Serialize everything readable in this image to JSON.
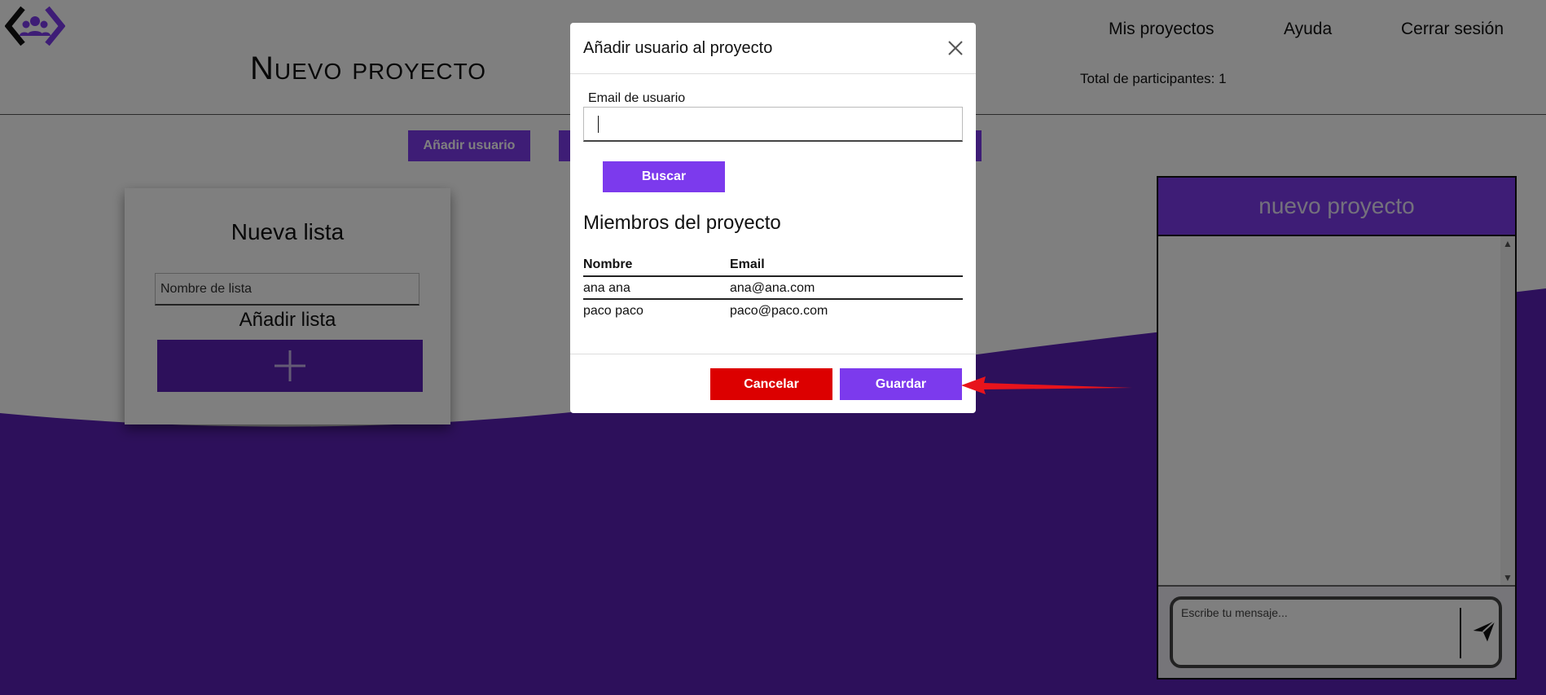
{
  "colors": {
    "accent": "#7c3aed",
    "wave": "#5b21b6",
    "danger": "#dc0000",
    "annotation": "#e8141c"
  },
  "header": {
    "logo_icon": "people-group-brackets-icon",
    "nav": {
      "projects": "Mis proyectos",
      "help": "Ayuda",
      "logout": "Cerrar sesión"
    },
    "project_title": "Nuevo proyecto",
    "participants": "Total de participantes: 1"
  },
  "toolbar": {
    "add_user_label": "Añadir usuario"
  },
  "list_card": {
    "title": "Nueva lista",
    "input_placeholder": "Nombre de lista",
    "subtitle": "Añadir lista",
    "add_icon": "plus-icon"
  },
  "chat": {
    "title": "nuevo proyecto",
    "input_placeholder": "Escribe tu mensaje...",
    "send_icon": "send-icon"
  },
  "modal": {
    "title": "Añadir usuario al proyecto",
    "close_icon": "close-icon",
    "email_label": "Email de usuario",
    "email_value": "",
    "search_label": "Buscar",
    "members_title": "Miembros del proyecto",
    "columns": [
      "Nombre",
      "Email"
    ],
    "rows": [
      {
        "name": "ana ana",
        "email": "ana@ana.com"
      },
      {
        "name": "paco paco",
        "email": "paco@paco.com"
      }
    ],
    "cancel_label": "Cancelar",
    "save_label": "Guardar"
  },
  "annotation": {
    "arrow_icon": "red-arrow-icon"
  }
}
